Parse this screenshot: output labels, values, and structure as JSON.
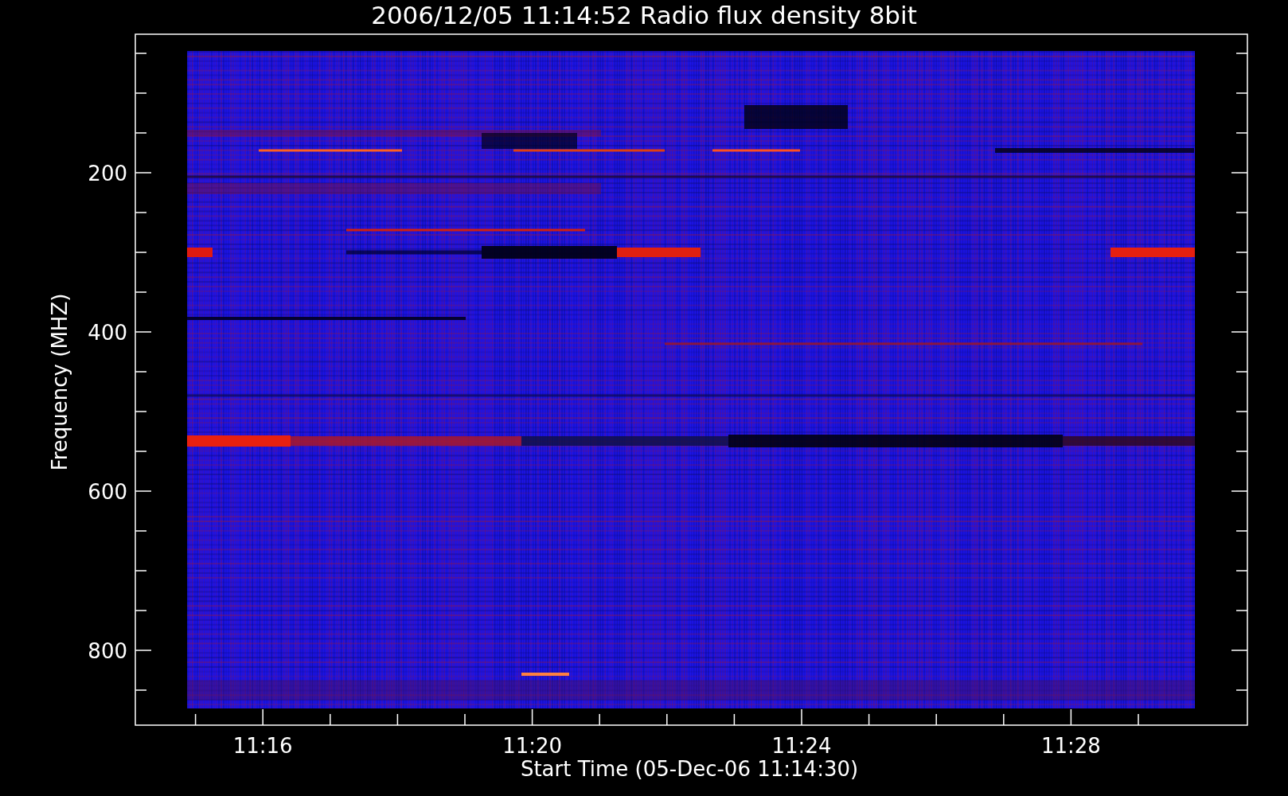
{
  "title": "2006/12/05 11:14:52 Radio flux density 8bit",
  "y_axis": {
    "label": "Frequency (MHZ)",
    "tick_labels": [
      "200",
      "400",
      "600",
      "800"
    ]
  },
  "x_axis": {
    "label": "Start Time (05-Dec-06 11:14:30)",
    "tick_labels": [
      "11:16",
      "11:20",
      "11:24",
      "11:28"
    ]
  }
}
